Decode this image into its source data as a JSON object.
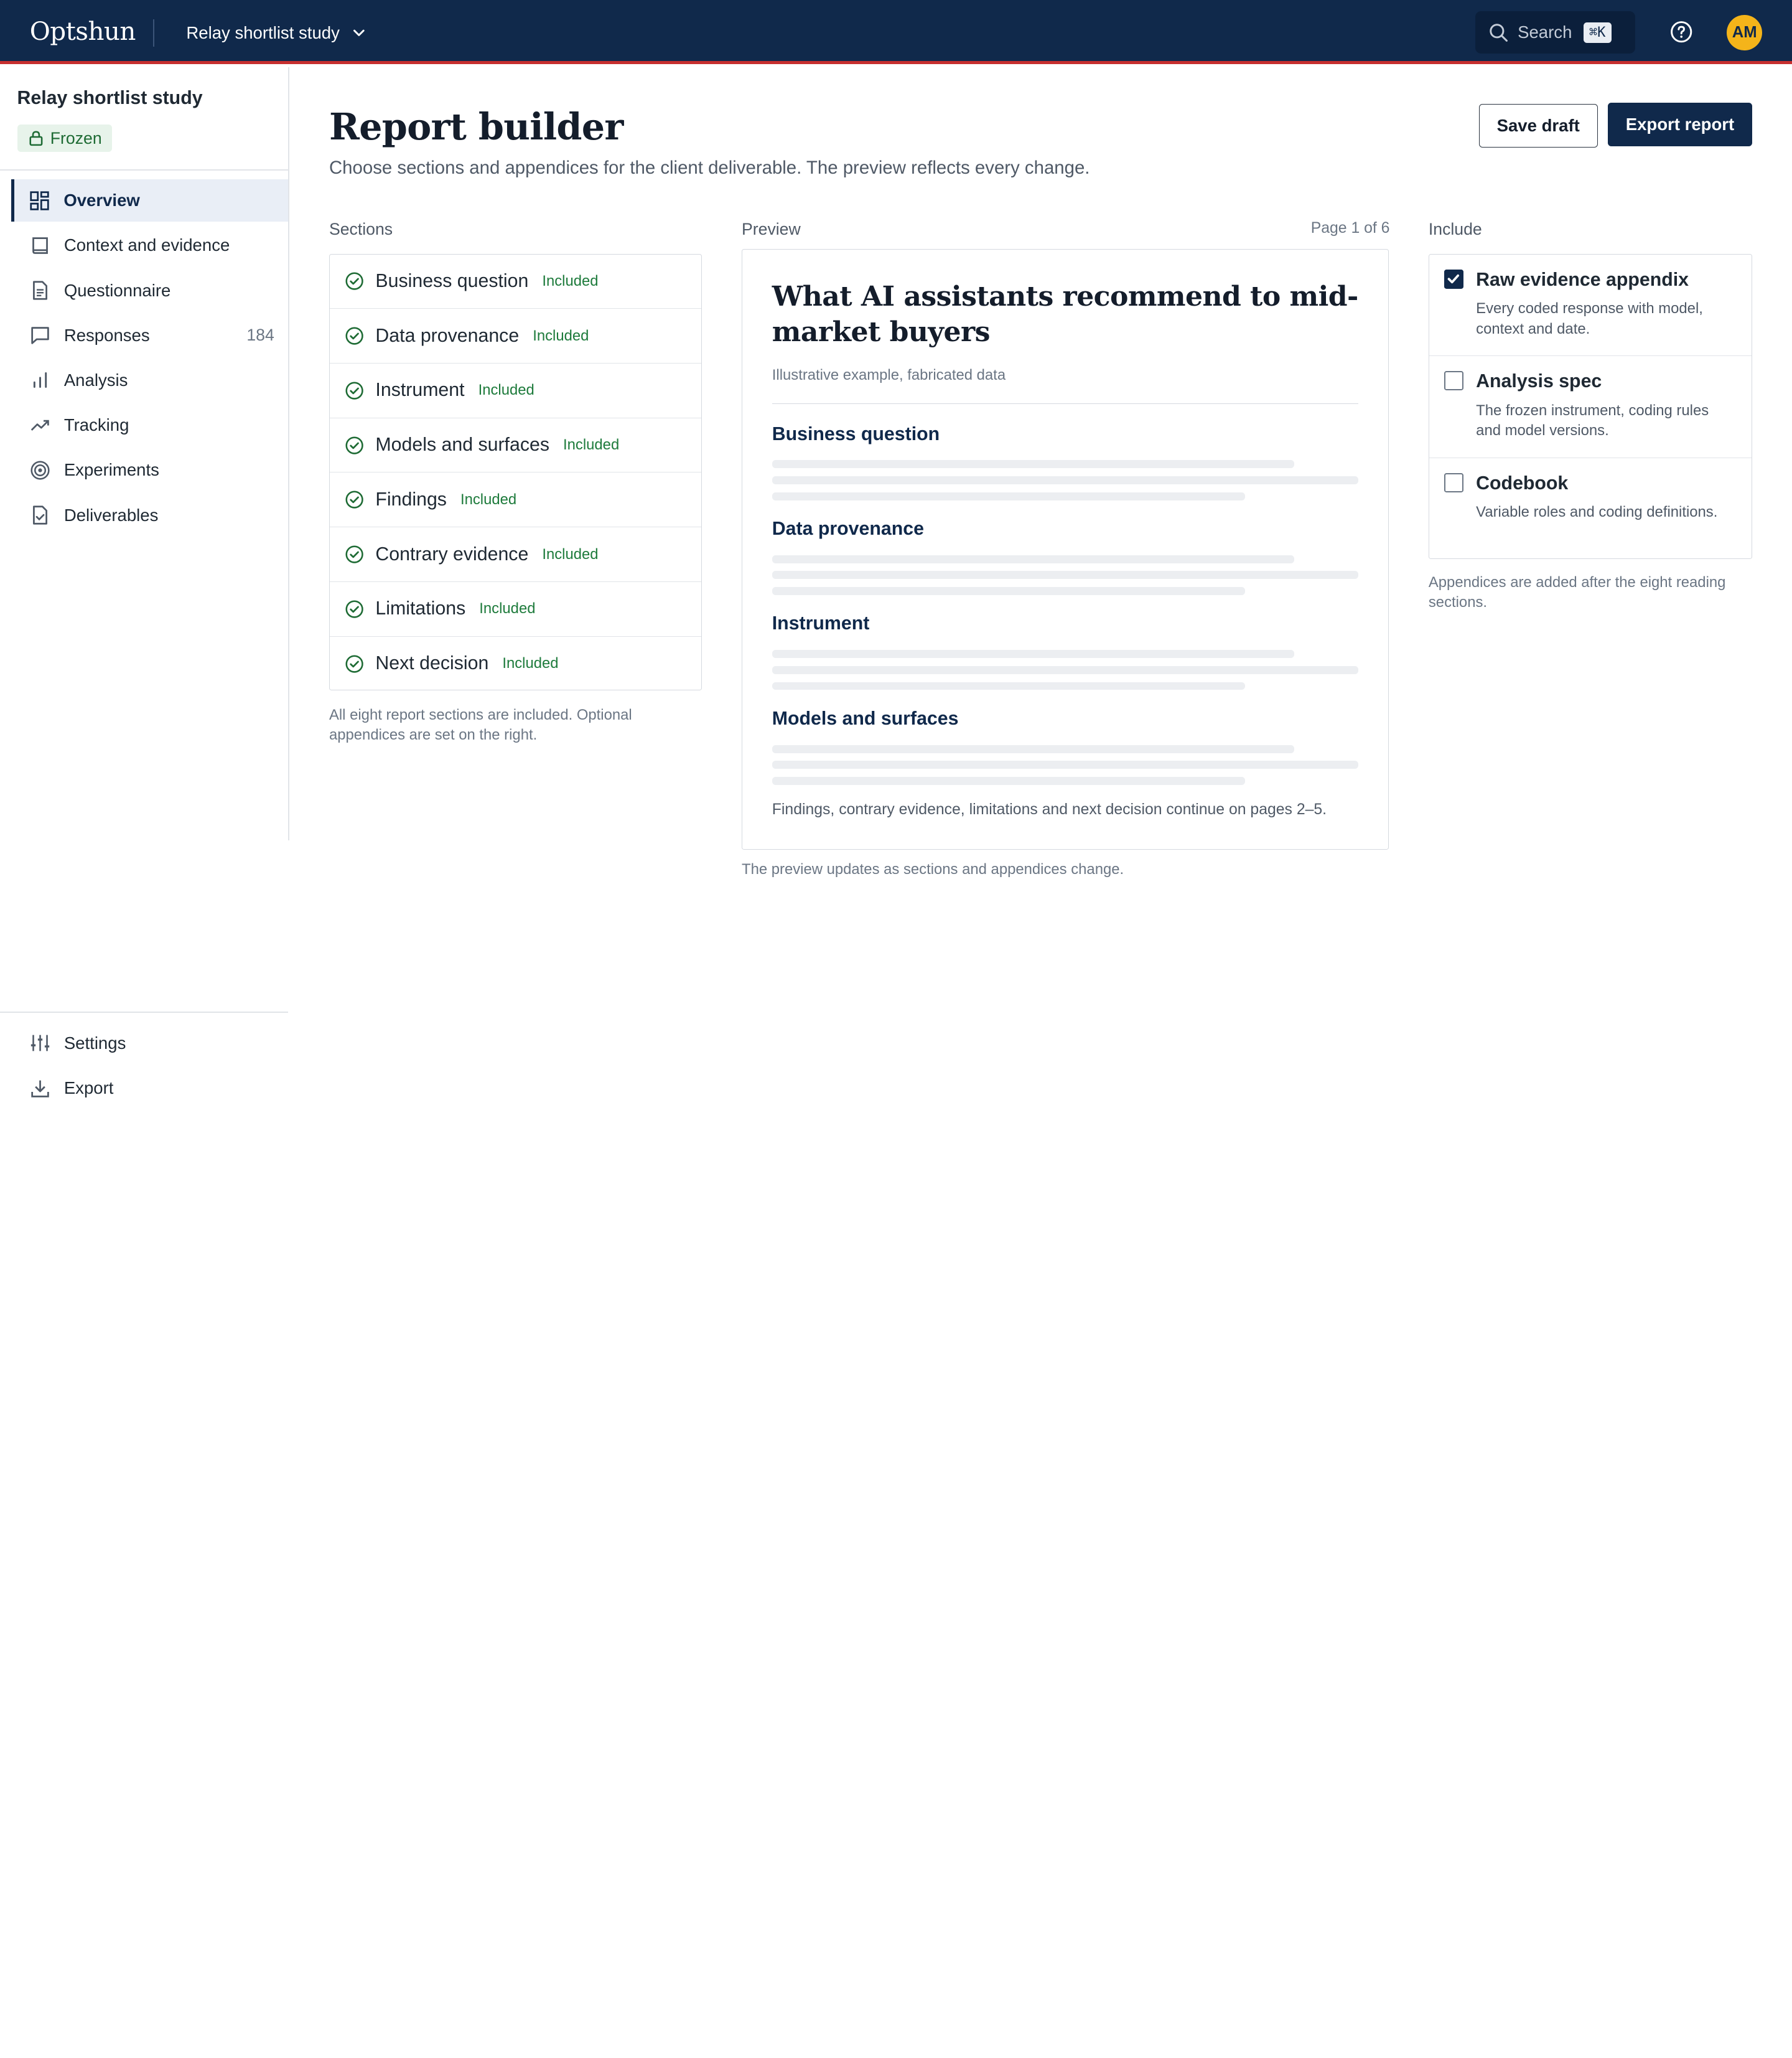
{
  "app": {
    "logo": "Optshun",
    "study_switcher": "Relay shortlist study",
    "search_label": "Search",
    "search_shortcut": "⌘K",
    "avatar_initials": "AM"
  },
  "sidebar": {
    "study_title": "Relay shortlist study",
    "status_badge": "Frozen",
    "items": [
      {
        "label": "Overview",
        "icon": "grid-icon",
        "active": true
      },
      {
        "label": "Context and evidence",
        "icon": "book-icon"
      },
      {
        "label": "Questionnaire",
        "icon": "document-icon"
      },
      {
        "label": "Responses",
        "icon": "message-icon",
        "count": "184"
      },
      {
        "label": "Analysis",
        "icon": "bar-chart-icon"
      },
      {
        "label": "Tracking",
        "icon": "trend-icon"
      },
      {
        "label": "Experiments",
        "icon": "target-icon"
      },
      {
        "label": "Deliverables",
        "icon": "file-check-icon"
      }
    ],
    "bottom_items": [
      {
        "label": "Settings",
        "icon": "sliders-icon"
      },
      {
        "label": "Export",
        "icon": "download-icon"
      }
    ]
  },
  "page": {
    "title": "Report builder",
    "subtitle": "Choose sections and appendices for the client deliverable. The preview reflects every change.",
    "save_draft": "Save draft",
    "export_report": "Export report"
  },
  "sections": {
    "label": "Sections",
    "items": [
      {
        "name": "Business question",
        "status": "Included"
      },
      {
        "name": "Data provenance",
        "status": "Included"
      },
      {
        "name": "Instrument",
        "status": "Included"
      },
      {
        "name": "Models and surfaces",
        "status": "Included"
      },
      {
        "name": "Findings",
        "status": "Included"
      },
      {
        "name": "Contrary evidence",
        "status": "Included"
      },
      {
        "name": "Limitations",
        "status": "Included"
      },
      {
        "name": "Next decision",
        "status": "Included"
      }
    ],
    "note": "All eight report sections are included. Optional appendices are set on the right."
  },
  "preview": {
    "label": "Preview",
    "page_indicator": "Page 1 of 6",
    "title": "What AI assistants recommend to mid-market buyers",
    "subtitle": "Illustrative example, fabricated data",
    "headings": [
      "Business question",
      "Data provenance",
      "Instrument",
      "Models and surfaces"
    ],
    "footer": "Findings, contrary evidence, limitations and next decision continue on pages 2–5.",
    "note": "The preview updates as sections and appendices change."
  },
  "include": {
    "label": "Include",
    "items": [
      {
        "title": "Raw evidence appendix",
        "desc": "Every coded response with model, context and date.",
        "checked": true
      },
      {
        "title": "Analysis spec",
        "desc": "The frozen instrument, coding rules and model versions.",
        "checked": false
      },
      {
        "title": "Codebook",
        "desc": "Variable roles and coding definitions.",
        "checked": false
      }
    ],
    "note": "Appendices are added after the eight reading sections."
  },
  "colors": {
    "topbar": "#10294b",
    "accent_rule": "#c62f2f",
    "included_green": "#1e7b3c",
    "avatar": "#f4b41a"
  }
}
